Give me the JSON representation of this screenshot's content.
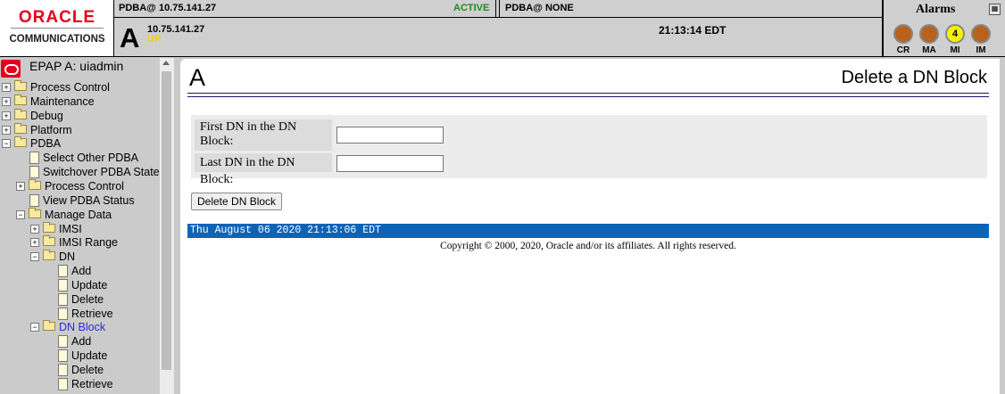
{
  "header": {
    "logo_top": "ORACLE",
    "logo_bottom": "COMMUNICATIONS",
    "pdba_primary": "PDBA@ 10.75.141.27",
    "pdba_primary_state": "ACTIVE",
    "pdba_secondary": "PDBA@ NONE",
    "server_letter": "A",
    "server_ip": "10.75.141.27",
    "server_status": "UP",
    "clock": "21:13:14 EDT",
    "alarms_title": "Alarms",
    "alarms": [
      {
        "label": "CR",
        "count": "",
        "color": "#b8621e"
      },
      {
        "label": "MA",
        "count": "",
        "color": "#b8621e"
      },
      {
        "label": "MI",
        "count": "4",
        "color": "#f2f200"
      },
      {
        "label": "IM",
        "count": "",
        "color": "#b8621e"
      }
    ]
  },
  "sidebar": {
    "title": "EPAP A: uiadmin",
    "items": [
      {
        "label": "Process Control",
        "type": "folder",
        "expander": "+"
      },
      {
        "label": "Maintenance",
        "type": "folder",
        "expander": "+"
      },
      {
        "label": "Debug",
        "type": "folder",
        "expander": "+"
      },
      {
        "label": "Platform",
        "type": "folder",
        "expander": "+"
      },
      {
        "label": "PDBA",
        "type": "folder-open",
        "expander": "−"
      },
      {
        "label": "Select Other PDBA",
        "type": "doc"
      },
      {
        "label": "Switchover PDBA State",
        "type": "doc"
      },
      {
        "label": "Process Control",
        "type": "folder",
        "expander": "+"
      },
      {
        "label": "View PDBA Status",
        "type": "doc"
      },
      {
        "label": "Manage Data",
        "type": "folder-open",
        "expander": "−"
      },
      {
        "label": "IMSI",
        "type": "folder",
        "expander": "+"
      },
      {
        "label": "IMSI Range",
        "type": "folder",
        "expander": "+"
      },
      {
        "label": "DN",
        "type": "folder-open",
        "expander": "−"
      },
      {
        "label": "Add",
        "type": "doc"
      },
      {
        "label": "Update",
        "type": "doc"
      },
      {
        "label": "Delete",
        "type": "doc"
      },
      {
        "label": "Retrieve",
        "type": "doc"
      },
      {
        "label": "DN Block",
        "type": "folder-open",
        "expander": "−",
        "selected": true
      },
      {
        "label": "Add",
        "type": "doc"
      },
      {
        "label": "Update",
        "type": "doc"
      },
      {
        "label": "Delete",
        "type": "doc"
      },
      {
        "label": "Retrieve",
        "type": "doc"
      }
    ]
  },
  "main": {
    "server_letter": "A",
    "title": "Delete a DN Block",
    "form": {
      "first_dn_label": "First DN in the DN Block:",
      "first_dn_value": "",
      "last_dn_label": "Last DN in the DN Block:",
      "last_dn_value": ""
    },
    "delete_button": "Delete DN Block",
    "timestamp": "Thu August 06 2020 21:13:06 EDT",
    "copyright": "Copyright © 2000, 2020, Oracle and/or its affiliates. All rights reserved."
  }
}
